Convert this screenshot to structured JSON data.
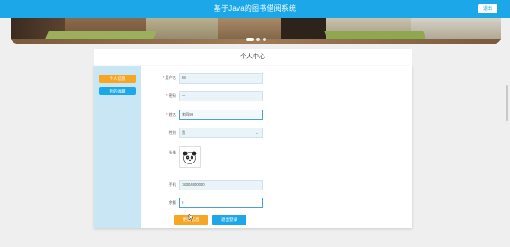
{
  "header": {
    "title": "基于Java的图书借阅系统",
    "exit_label": "退出"
  },
  "banner": {
    "slide_count": 3,
    "active_slide": 1
  },
  "page": {
    "title": "个人中心"
  },
  "sidebar": {
    "items": [
      {
        "label": "个人信息",
        "active": true
      },
      {
        "label": "我的收藏",
        "active": false
      }
    ]
  },
  "form": {
    "username": {
      "label": "用户名",
      "required": true,
      "value": "88"
    },
    "password": {
      "label": "密码",
      "required": true,
      "value": "—"
    },
    "name": {
      "label": "姓名",
      "required": true,
      "value": "李四98"
    },
    "gender": {
      "label": "性别",
      "value": "男"
    },
    "avatar": {
      "label": "头像"
    },
    "phone": {
      "label": "手机",
      "value": "18304400000"
    },
    "balance": {
      "label": "余额",
      "value": "0"
    }
  },
  "actions": {
    "save_label": "更新信息",
    "recharge_label": "退出登录"
  },
  "colors": {
    "primary": "#1ba7e8",
    "accent": "#f6a623",
    "sidebar": "#c9e6f5"
  }
}
